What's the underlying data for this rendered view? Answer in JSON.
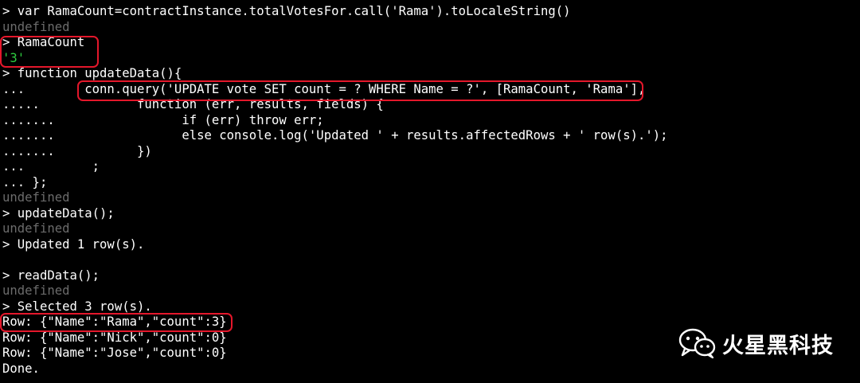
{
  "terminal": {
    "lines": [
      "> var RamaCount=contractInstance.totalVotesFor.call('Rama').toLocaleString()",
      "undefined",
      "> RamaCount",
      "'3'",
      "> function updateData(){",
      "...        conn.query('UPDATE vote SET count = ? WHERE Name = ?', [RamaCount, 'Rama'],",
      ".....             function (err, results, fields) {",
      ".......                 if (err) throw err;",
      ".......                 else console.log('Updated ' + results.affectedRows + ' row(s).');",
      ".......           })",
      "...         ;",
      "... };",
      "undefined",
      "> updateData();",
      "undefined",
      "> Updated 1 row(s).",
      "",
      "> readData();",
      "undefined",
      "> Selected 3 row(s).",
      "Row: {\"Name\":\"Rama\",\"count\":3}",
      "Row: {\"Name\":\"Nick\",\"count\":0}",
      "Row: {\"Name\":\"Jose\",\"count\":0}",
      "Done."
    ]
  },
  "watermark": {
    "text": "火星黑科技",
    "icon": "wechat-icon"
  },
  "colors": {
    "background": "#000000",
    "text": "#ffffff",
    "undefined_text": "#6b6b6b",
    "string_result": "#2ecc40",
    "highlight_box": "#e4172b"
  }
}
